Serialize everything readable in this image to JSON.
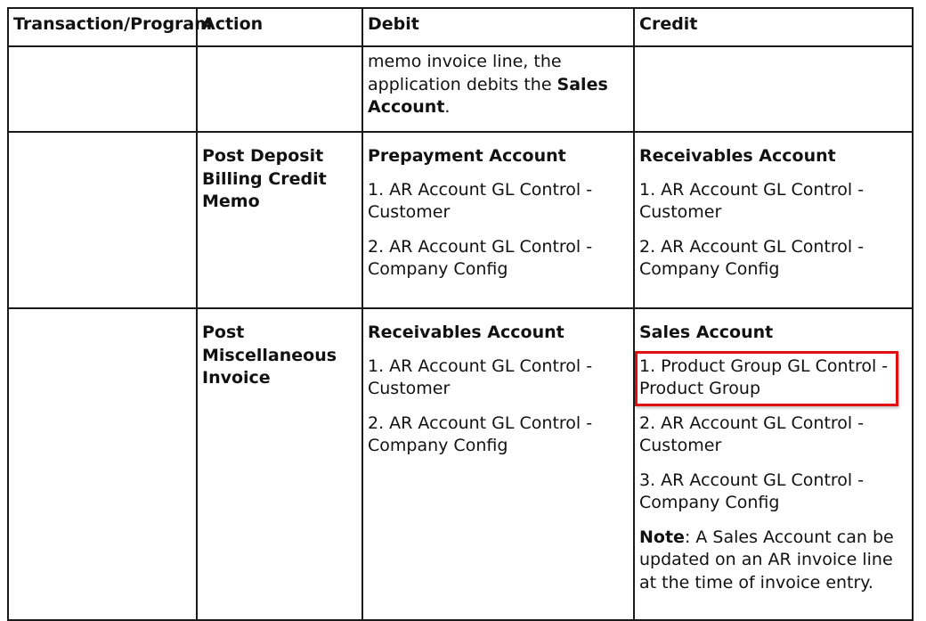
{
  "table": {
    "headers": {
      "transaction_program": "Transaction/Program",
      "action": "Action",
      "debit": "Debit",
      "credit": "Credit"
    },
    "row_memo": {
      "debit_prefix": "memo invoice line, the application debits the ",
      "debit_bold": "Sales Account",
      "debit_suffix": "."
    },
    "row_deposit": {
      "action": "Post Deposit Billing Credit Memo",
      "debit_title": "Prepayment Account",
      "debit_items": [
        "1. AR Account GL Control - Customer",
        "2. AR Account GL Control - Company Config"
      ],
      "credit_title": "Receivables Account",
      "credit_items": [
        "1. AR Account GL Control - Customer",
        "2. AR Account GL Control - Company Config"
      ]
    },
    "row_misc": {
      "action": "Post Miscellaneous Invoice",
      "debit_title": "Receivables Account",
      "debit_items": [
        "1. AR Account GL Control - Customer",
        "2. AR Account GL Control - Company Config"
      ],
      "credit_title": "Sales Account",
      "credit_items": [
        "1. Product Group GL Control - Product Group",
        "2. AR Account GL Control - Customer",
        "3. AR Account GL Control - Company Config"
      ],
      "note_label": "Note",
      "note_text": ": A Sales Account can be updated on an AR invoice line at the time of invoice entry."
    }
  },
  "highlight_color": "#e01010"
}
